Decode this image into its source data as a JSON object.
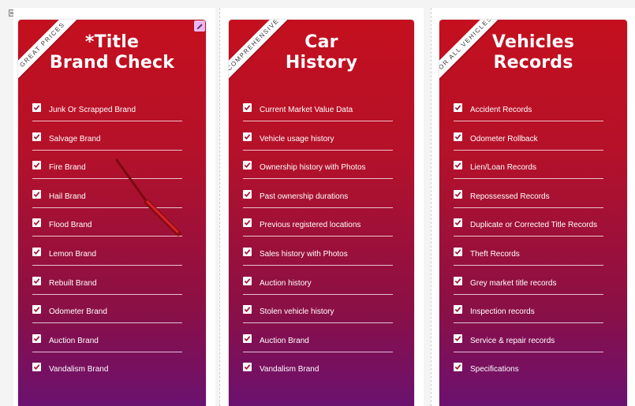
{
  "cards": [
    {
      "ribbon": "GREAT PRICES",
      "title_lines": [
        "*Title",
        "Brand Check"
      ],
      "items": [
        "Junk Or Scrapped Brand",
        "Salvage Brand",
        "Fire Brand",
        "Hail Brand",
        "Flood Brand",
        "Lemon Brand",
        "Rebuilt Brand",
        "Odometer Brand",
        "Auction Brand",
        "Vandalism Brand"
      ]
    },
    {
      "ribbon": "COMPREHENSIVE",
      "title_lines": [
        "Car",
        "History"
      ],
      "items": [
        "Current Market Value Data",
        "Vehicle usage history",
        "Ownership history with Photos",
        "Past ownership durations",
        "Previous registered locations",
        "Sales history with Photos",
        "Auction history",
        "Stolen vehicle history",
        "Auction Brand",
        "Vandalism Brand"
      ]
    },
    {
      "ribbon": "FOR ALL VEHICLES",
      "title_lines": [
        "Vehicles",
        "Records"
      ],
      "items": [
        "Accident Records",
        "Odometer Rollback",
        "Lien/Loan Records",
        "Repossessed Records",
        "Duplicate or Corrected Title Records",
        "Theft Records",
        "Grey market title records",
        "Inspection records",
        "Service & repair records",
        "Specifications"
      ]
    }
  ],
  "colors": {
    "card_top": "#c4101e",
    "card_bottom": "#6b1170",
    "edit_badge": "#e9b8f0"
  },
  "icons": {
    "check": "checkbox-checked-icon",
    "edit": "pencil-icon",
    "toggle": "collapse-toggle-icon"
  }
}
